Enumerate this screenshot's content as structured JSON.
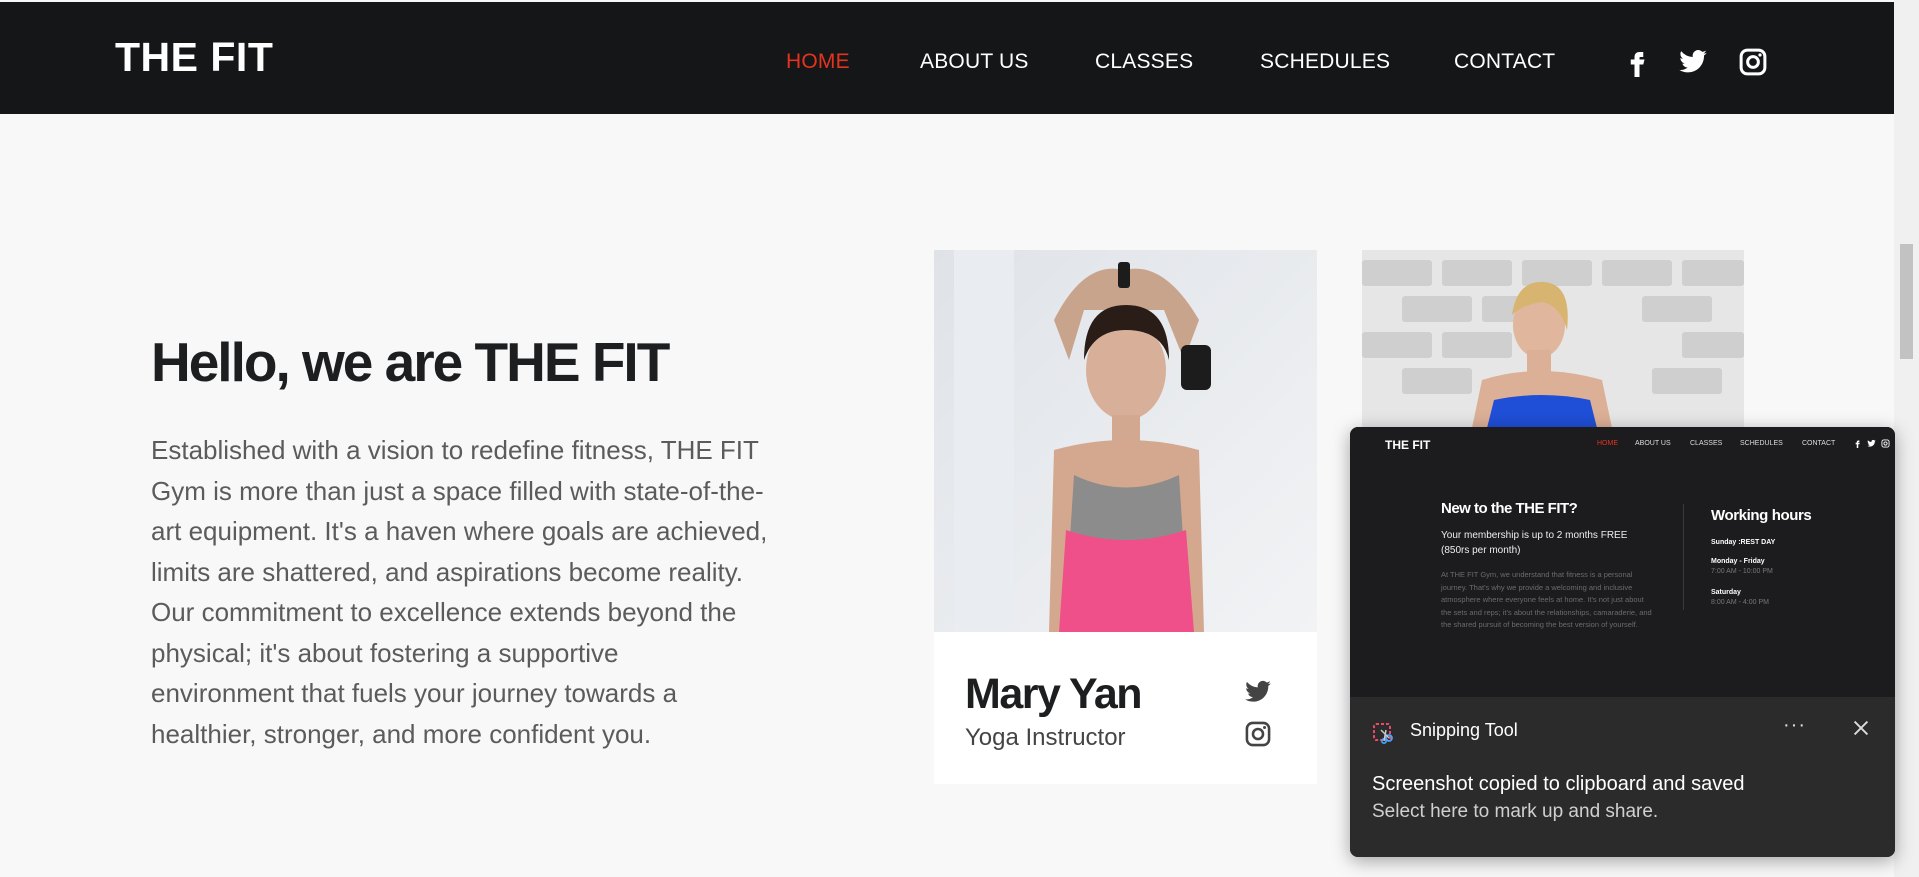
{
  "brand": "THE FIT",
  "nav": [
    {
      "label": "HOME",
      "active": true
    },
    {
      "label": "ABOUT US",
      "active": false
    },
    {
      "label": "CLASSES",
      "active": false
    },
    {
      "label": "SCHEDULES",
      "active": false
    },
    {
      "label": "CONTACT",
      "active": false
    }
  ],
  "social_icons": [
    "facebook-icon",
    "twitter-icon",
    "instagram-icon"
  ],
  "colors": {
    "accent": "#e5331f",
    "header_bg": "#151617",
    "page_bg": "#f8f8f8"
  },
  "hero": {
    "title": "Hello, we are THE FIT",
    "lines": [
      "Established with a vision to redefine fitness, THE FIT",
      "Gym is more than just a space filled with state-of-the-",
      "art equipment. It's a haven where goals are achieved,",
      "limits are shattered, and aspirations become reality.",
      "Our commitment to excellence extends beyond the",
      "physical; it's about fostering a supportive",
      "environment that fuels your journey towards a",
      "healthier, stronger, and more confident you."
    ]
  },
  "trainer": {
    "name": "Mary Yan",
    "role": "Yoga Instructor",
    "icons": [
      "twitter-icon",
      "instagram-icon"
    ]
  },
  "toast": {
    "app": "Snipping Tool",
    "more": "···",
    "message": "Screenshot copied to clipboard and saved",
    "sub": "Select here to mark up and share.",
    "preview": {
      "brand": "THE FIT",
      "nav": [
        "HOME",
        "ABOUT US",
        "CLASSES",
        "SCHEDULES",
        "CONTACT"
      ],
      "heading": "New to the THE FIT?",
      "subtext": "Your membership is up to 2 months FREE (850rs per month)",
      "body": "At THE FIT Gym, we understand that fitness is a personal journey. That's why we provide a welcoming and inclusive atmosphere where everyone feels at home. It's not just about the sets and reps; it's about the relationships, camaraderie, and the shared pursuit of becoming the best version of yourself.",
      "hours_title": "Working hours",
      "hours": [
        {
          "day": "Sunday :REST DAY",
          "time": ""
        },
        {
          "day": "Monday - Friday",
          "time": "7:00 AM - 10:00 PM"
        },
        {
          "day": "Saturday",
          "time": "8:00 AM - 4:00 PM"
        }
      ]
    }
  }
}
